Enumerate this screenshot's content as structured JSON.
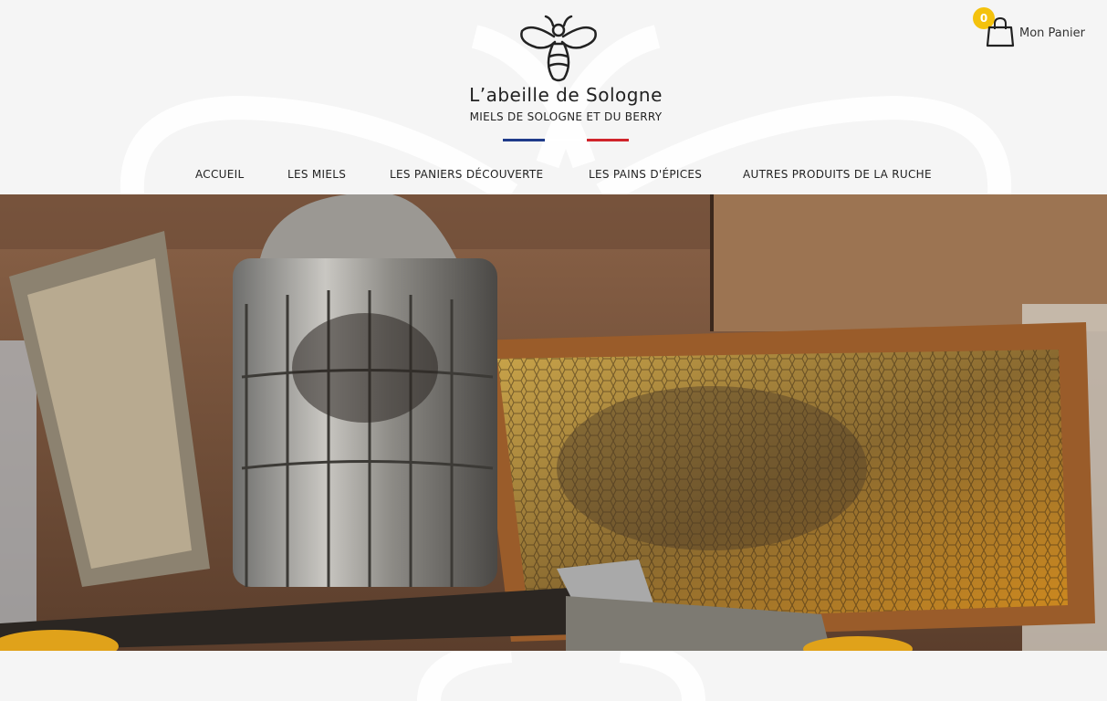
{
  "brand": {
    "name": "L’abeille de Sologne",
    "tagline": "MIELS DE SOLOGNE ET DU BERRY"
  },
  "cart": {
    "count": "0",
    "label": "Mon Panier"
  },
  "nav": {
    "items": [
      {
        "label": "ACCUEIL"
      },
      {
        "label": "LES MIELS"
      },
      {
        "label": "LES PANIERS DÉCOUVERTE"
      },
      {
        "label": "LES PAINS D'ÉPICES"
      },
      {
        "label": "AUTRES PRODUITS DE LA RUCHE"
      }
    ]
  },
  "colors": {
    "accent": "#f4c20d",
    "flag_blue": "#1f3b8a",
    "flag_red": "#d0242b",
    "background": "#f5f5f5"
  },
  "icons": {
    "cart": "shopping-bag-icon",
    "logo": "bee-logo-icon"
  },
  "hero": {
    "image": "beekeeping-smoker-and-honeycomb-frame"
  }
}
